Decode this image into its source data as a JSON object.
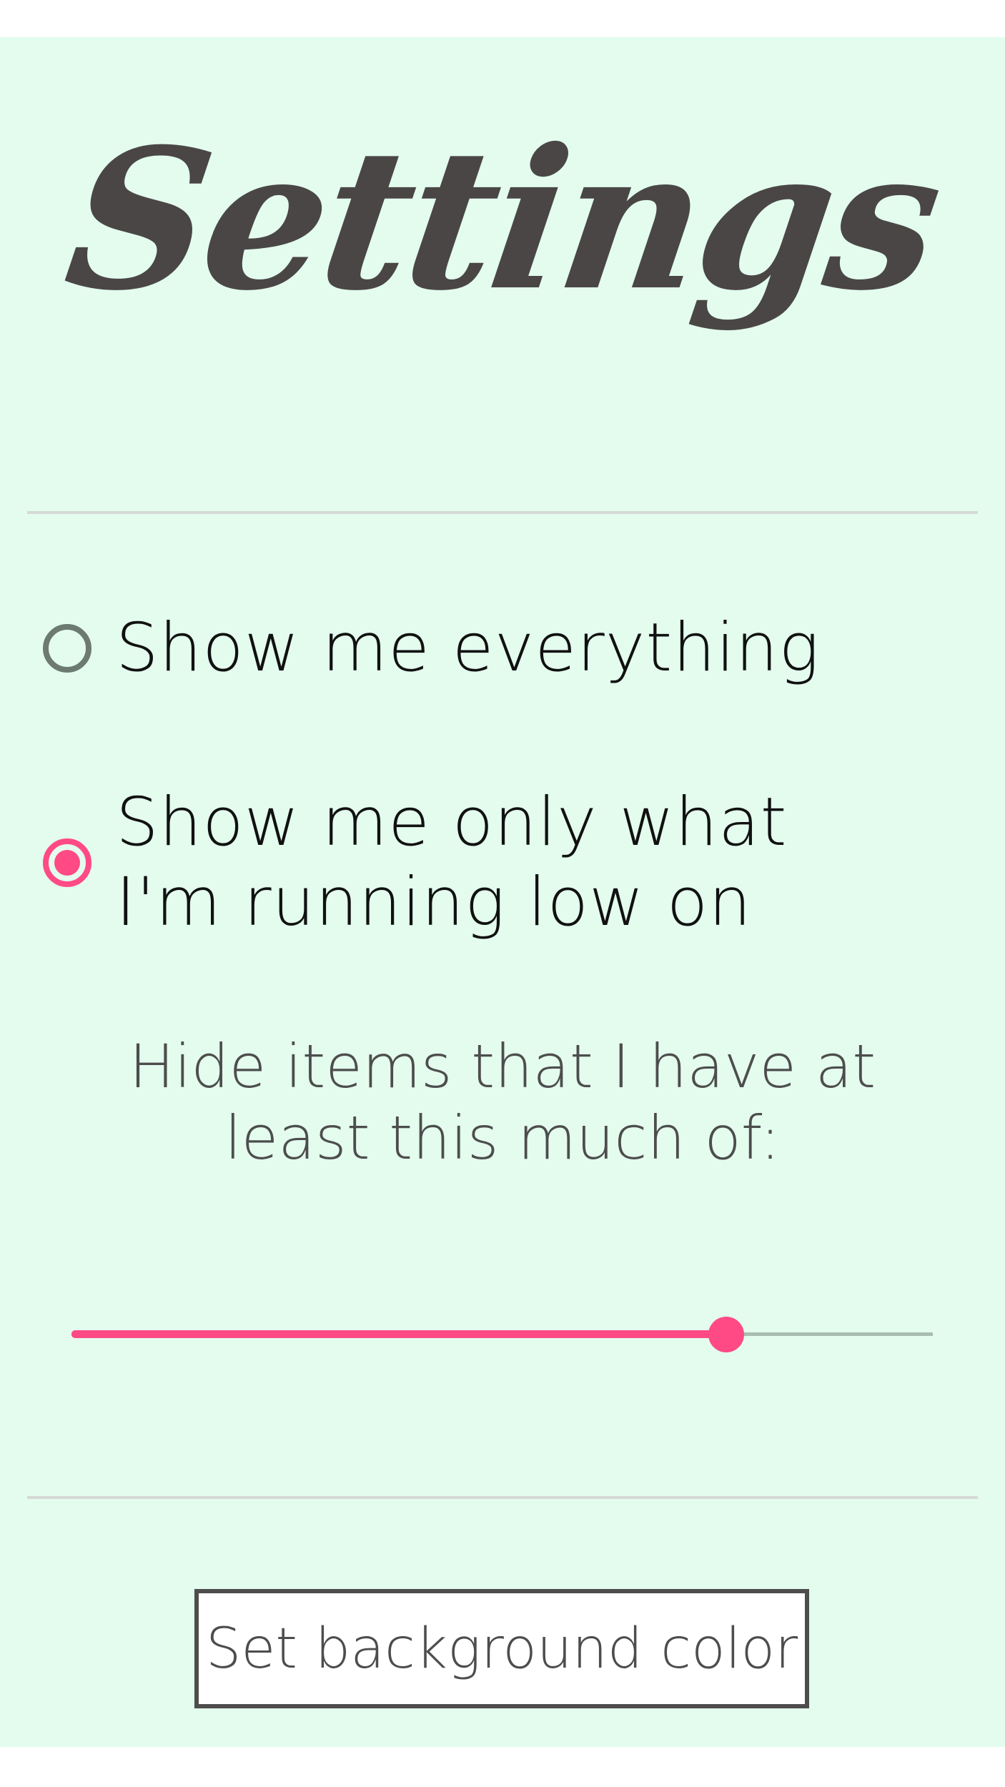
{
  "header": {
    "title": "Settings"
  },
  "options": [
    {
      "label": "Show me everything",
      "selected": false
    },
    {
      "label": "Show me only what I'm running low on",
      "selected": true
    }
  ],
  "threshold": {
    "label": "Hide items that I have at least this much of:",
    "value_fraction": 0.76
  },
  "footer": {
    "button_label": "Set background color"
  },
  "colors": {
    "background": "#e3fcee",
    "accent": "#ff4a86",
    "text": "#4a4646",
    "track": "#a9bdb3"
  }
}
